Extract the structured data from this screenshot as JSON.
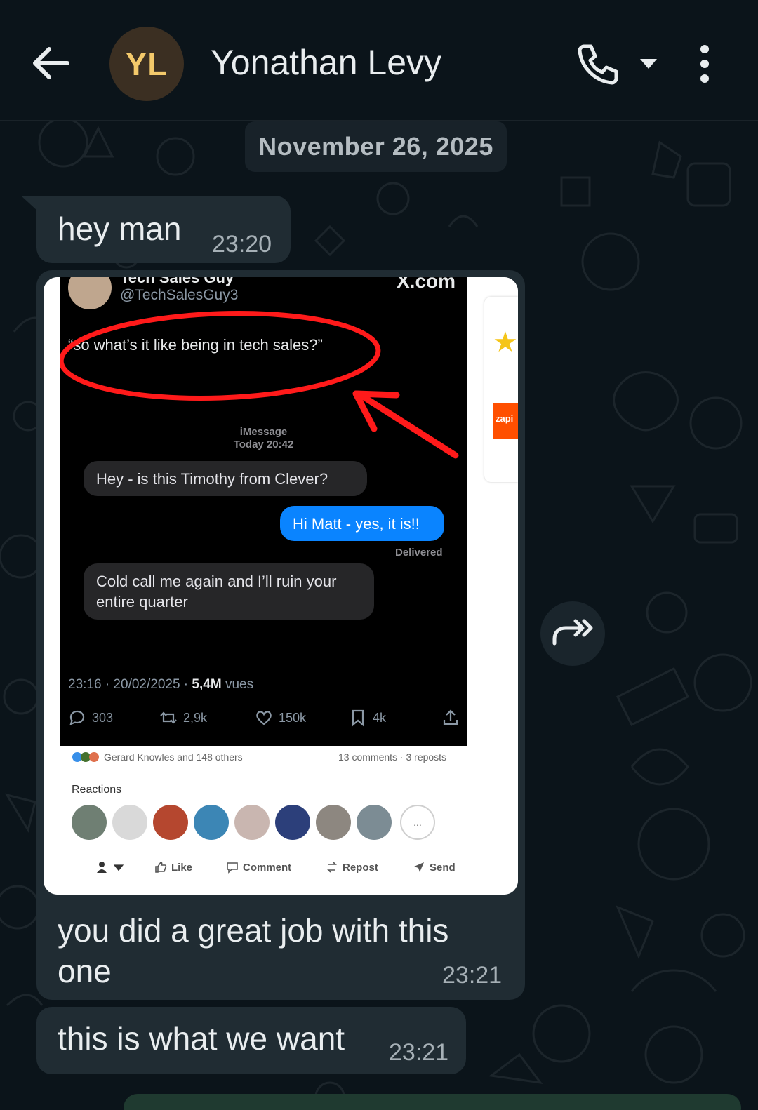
{
  "header": {
    "avatar_initials": "YL",
    "contact_name": "Yonathan Levy"
  },
  "chat": {
    "date_chip": "November 26, 2025",
    "messages": [
      {
        "text": "hey man",
        "time": "23:20"
      },
      {
        "text": "you did a great job with this one",
        "time": "23:21",
        "has_media": true
      },
      {
        "text": "this is what we want",
        "time": "23:21"
      }
    ]
  },
  "media": {
    "tweet": {
      "author_name": "Tech Sales Guy",
      "handle": "@TechSalesGuy3",
      "site": "X.com",
      "quote": "“so what’s it like being in tech sales?”",
      "imessage_label": "iMessage",
      "imessage_time": "Today 20:42",
      "messages": [
        "Hey - is this Timothy from Clever?",
        "Hi Matt - yes, it is!!",
        "Cold call me again and I’ll ruin your entire quarter"
      ],
      "delivered": "Delivered",
      "meta_time": "23:16 · 20/02/2025 · ",
      "meta_views": "5,4M",
      "meta_views_label": " vues",
      "replies": "303",
      "reposts": "2,9k",
      "likes": "150k",
      "bookmarks": "4k"
    },
    "linkedin": {
      "reactors_text": "Gerard Knowles and 148 others",
      "stats_text": "13 comments · 3 reposts",
      "reactions_label": "Reactions",
      "more_label": "...",
      "actions": [
        "Like",
        "Comment",
        "Repost",
        "Send"
      ]
    },
    "side_card_text": "zapi"
  },
  "colors": {
    "background": "#0b141a",
    "bubble": "#202c33",
    "avatar_bg": "#3b2f22",
    "avatar_text": "#f3c96b",
    "annotation_red": "#ff1a1a",
    "imessage_blue": "#0a84ff"
  },
  "icons": [
    "back-arrow-icon",
    "phone-icon",
    "caret-down-icon",
    "more-vert-icon",
    "forward-icon"
  ]
}
